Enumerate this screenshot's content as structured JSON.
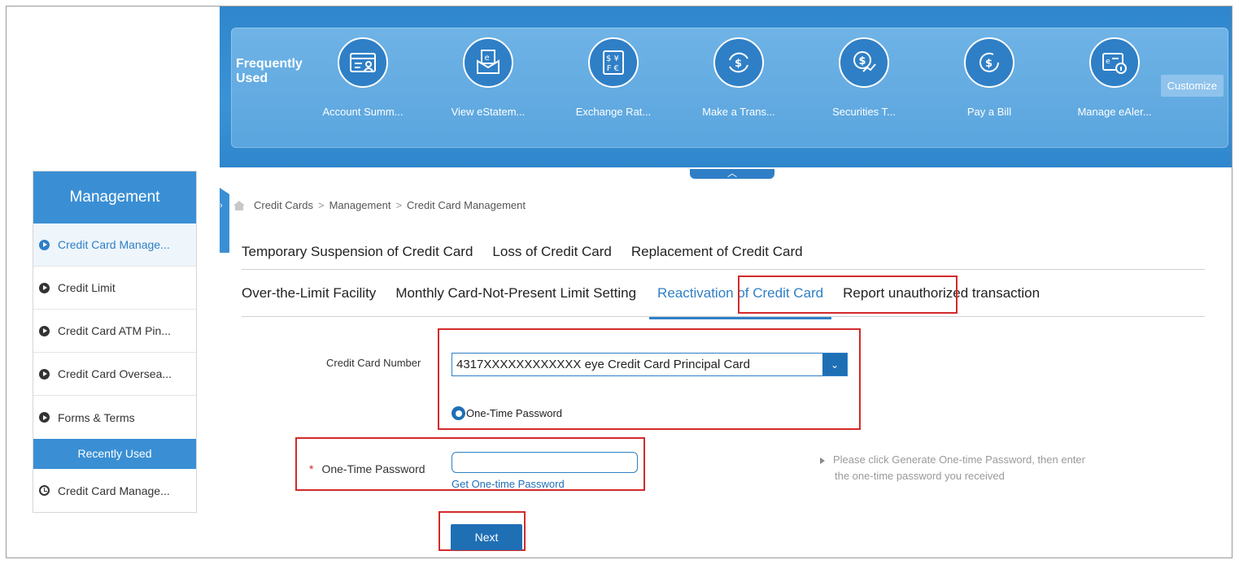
{
  "colors": {
    "banner": "#3a93d6",
    "accent": "#2f7fc6",
    "highlight_box": "#d32a2a"
  },
  "frequently_used": {
    "label": "Frequently Used",
    "customize_label": "Customize",
    "collapse_icon": "chevron-up-icon",
    "shortcuts": [
      {
        "label": "Account Summ...",
        "icon": "account-summary-icon"
      },
      {
        "label": "View eStatem...",
        "icon": "estatement-icon"
      },
      {
        "label": "Exchange Rat...",
        "icon": "exchange-rate-icon"
      },
      {
        "label": "Make a Trans...",
        "icon": "transfer-icon"
      },
      {
        "label": "Securities T...",
        "icon": "securities-icon"
      },
      {
        "label": "Pay a Bill",
        "icon": "pay-bill-icon"
      },
      {
        "label": "Manage eAler...",
        "icon": "ealert-icon"
      }
    ]
  },
  "sidebar": {
    "title": "Management",
    "items": [
      {
        "label": "Credit Card Manage..."
      },
      {
        "label": "Credit Limit"
      },
      {
        "label": "Credit Card ATM Pin..."
      },
      {
        "label": "Credit Card Oversea..."
      },
      {
        "label": "Forms & Terms"
      }
    ],
    "recent_title": "Recently Used",
    "recent_items": [
      {
        "label": "Credit Card Manage..."
      }
    ]
  },
  "breadcrumb": {
    "items": [
      "Credit Cards",
      "Management",
      "Credit Card Management"
    ],
    "separator": ">"
  },
  "tabs": {
    "row1": [
      "Temporary Suspension of Credit Card",
      "Loss of Credit Card",
      "Replacement of Credit Card"
    ],
    "row2": [
      "Over-the-Limit Facility",
      "Monthly Card-Not-Present Limit Setting",
      "Reactivation of Credit Card",
      "Report unauthorized transaction"
    ],
    "active": "Reactivation of Credit Card"
  },
  "form": {
    "credit_card_label": "Credit Card Number",
    "credit_card_value": "4317XXXXXXXXXXXX eye Credit Card Principal Card",
    "auth_option": "One-Time Password",
    "otp_required_mark": "*",
    "otp_label": "One-Time Password",
    "otp_value": "",
    "get_otp_link": "Get One-time Password",
    "hint_line1": "Please click Generate One-time Password, then enter",
    "hint_line2": "the one-time password you received",
    "next_label": "Next"
  }
}
